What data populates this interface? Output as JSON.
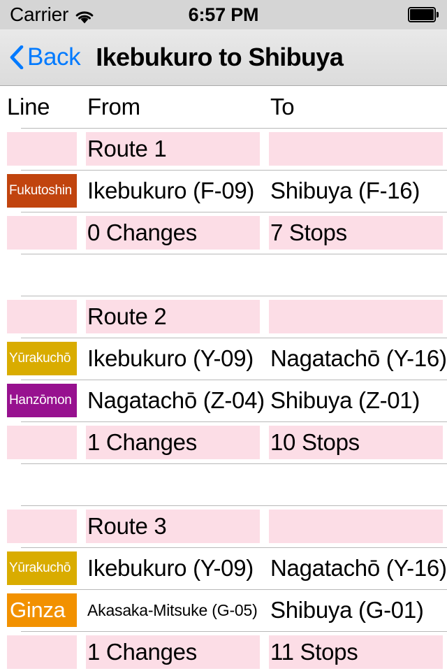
{
  "status_bar": {
    "carrier": "Carrier",
    "wifi_icon": "wifi-icon",
    "time": "6:57 PM",
    "battery_icon": "battery-full-icon"
  },
  "nav_bar": {
    "back_icon": "chevron-left-icon",
    "back_label": "Back",
    "title": "Ikebukuro to Shibuya"
  },
  "table": {
    "headers": {
      "line": "Line",
      "from": "From",
      "to": "To"
    },
    "routes": [
      {
        "title_line": "",
        "title_from": "Route 1",
        "title_to": "",
        "legs": [
          {
            "badge": "Fukutoshin",
            "badge_color": "#c1440e",
            "badge_size": "small",
            "from": "Ikebukuro (F-09)",
            "from_size": "normal",
            "to": "Shibuya (F-16)",
            "to_size": "normal"
          }
        ],
        "summary_line": "",
        "summary_changes": "0 Changes",
        "summary_stops": "7 Stops"
      },
      {
        "title_line": "",
        "title_from": "Route 2",
        "title_to": "",
        "legs": [
          {
            "badge": "Yūrakuchō",
            "badge_color": "#d9ac00",
            "badge_size": "small",
            "from": "Ikebukuro (Y-09)",
            "from_size": "normal",
            "to": "Nagatachō (Y-16)",
            "to_size": "normal"
          },
          {
            "badge": "Hanzōmon",
            "badge_color": "#97118f",
            "badge_size": "small",
            "from": "Nagatachō (Z-04)",
            "from_size": "normal",
            "to": "Shibuya (Z-01)",
            "to_size": "normal"
          }
        ],
        "summary_line": "",
        "summary_changes": "1 Changes",
        "summary_stops": "10 Stops"
      },
      {
        "title_line": "",
        "title_from": "Route 3",
        "title_to": "",
        "legs": [
          {
            "badge": "Yūrakuchō",
            "badge_color": "#d9ac00",
            "badge_size": "small",
            "from": "Ikebukuro (Y-09)",
            "from_size": "normal",
            "to": "Nagatachō (Y-16)",
            "to_size": "normal"
          },
          {
            "badge": "Ginza",
            "badge_color": "#f29100",
            "badge_size": "big",
            "from": "Akasaka-Mitsuke (G-05)",
            "from_size": "shrink",
            "to": "Shibuya (G-01)",
            "to_size": "normal"
          }
        ],
        "summary_line": "",
        "summary_changes": "1 Changes",
        "summary_stops": "11 Stops"
      }
    ]
  },
  "colors": {
    "accent_blue": "#007aff",
    "row_highlight_pink": "#fcdde6",
    "separator": "#b9b9b9",
    "statusbar_bg": "#d5d5d5",
    "navbar_bg": "#e2e2e2"
  }
}
